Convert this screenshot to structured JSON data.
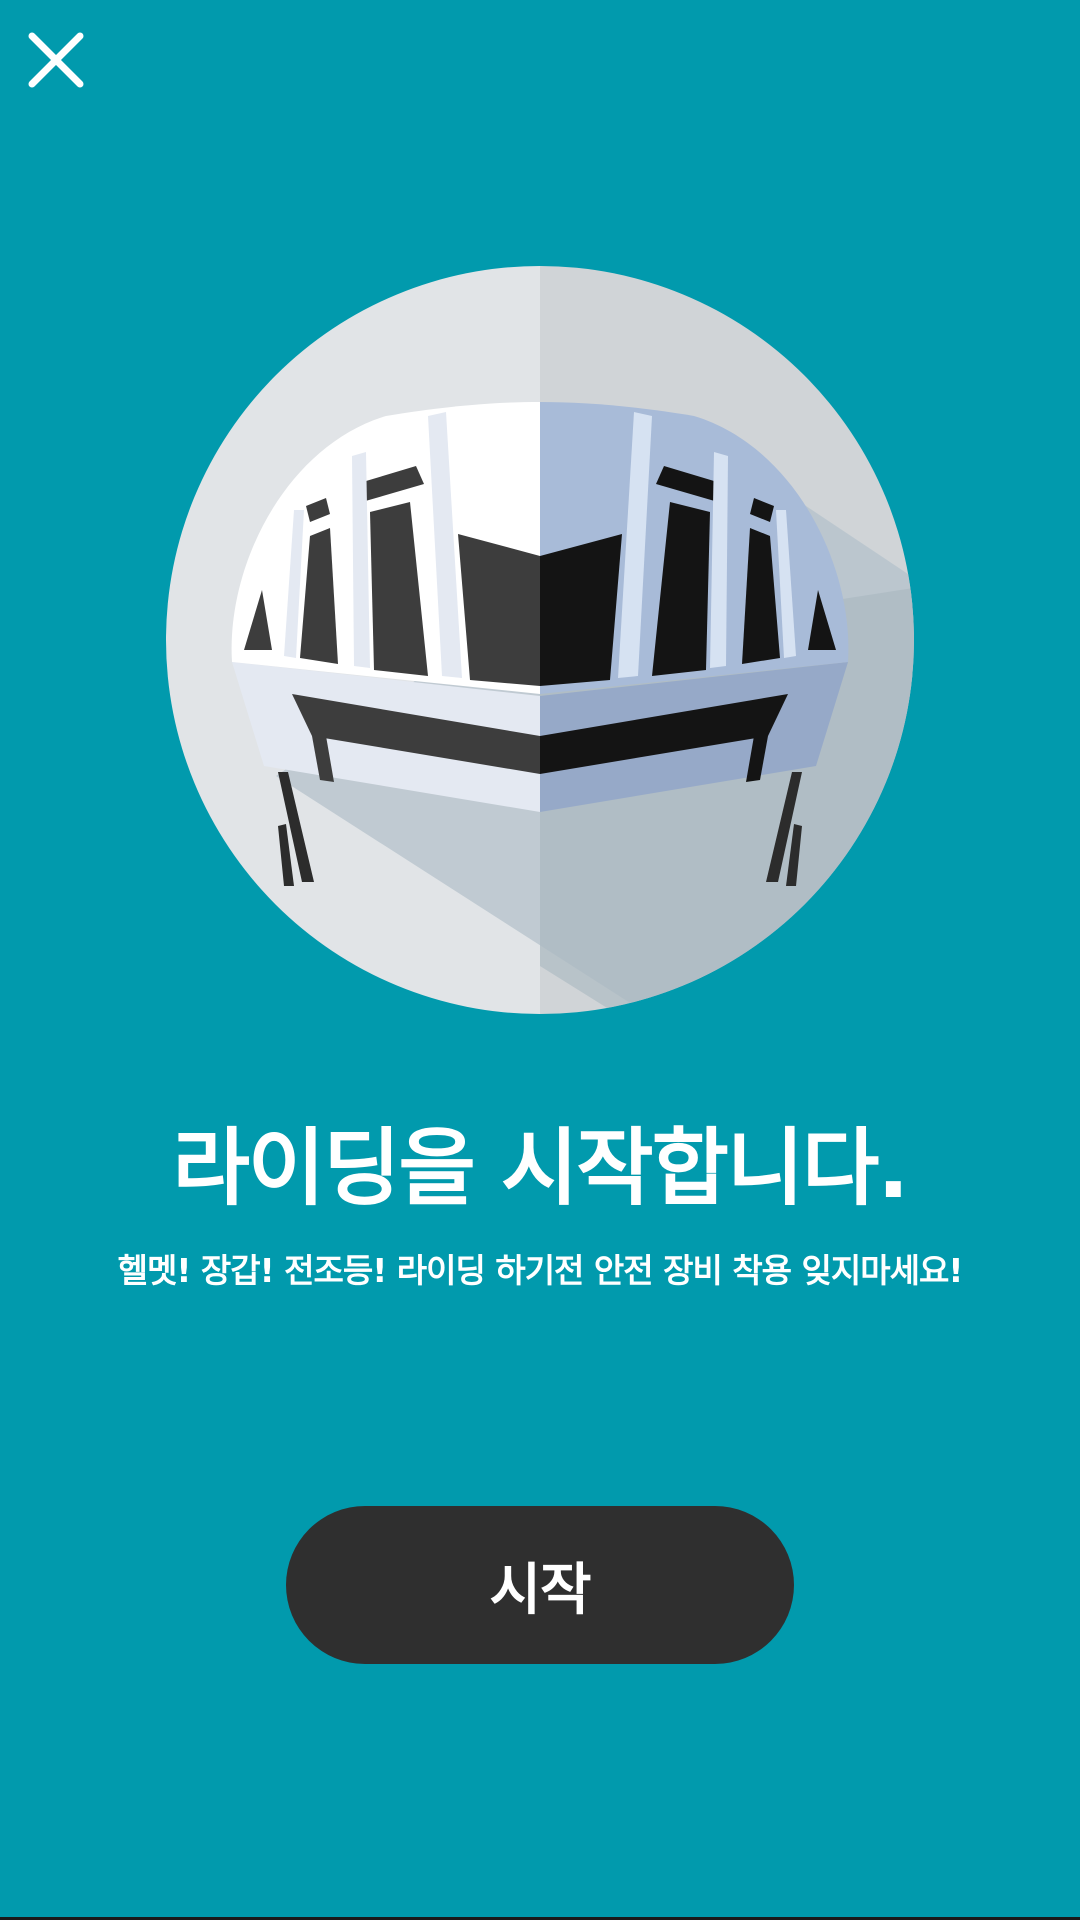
{
  "dialog": {
    "close_icon": "close-icon",
    "illustration_icon": "bicycle-helmet-icon",
    "title": "라이딩을 시작합니다.",
    "subtitle": "헬멧!  장갑!  전조등!  라이딩 하기전 안전 장비 착용 잊지마세요!",
    "start_button_label": "시작"
  },
  "colors": {
    "background": "#019aad",
    "button": "#2f2f2f",
    "text": "#ffffff"
  }
}
